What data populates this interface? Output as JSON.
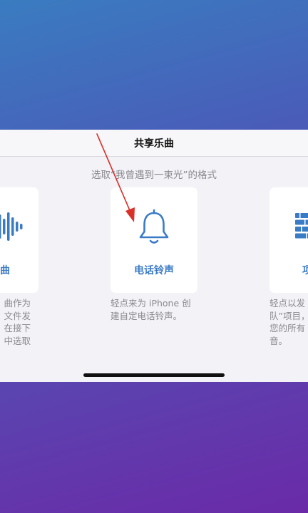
{
  "sheet": {
    "title": "共享乐曲",
    "subtitle": "选取“我曾遇到一束光”的格式"
  },
  "cards": {
    "left": {
      "label": "曲",
      "icon": "waveform-icon",
      "desc": [
        "曲作为",
        "文件发",
        "在接下",
        "中选取"
      ]
    },
    "center": {
      "label": "电话铃声",
      "icon": "bell-icon",
      "desc": [
        "轻点来为 iPhone 创",
        "建自定电话铃声。"
      ]
    },
    "right": {
      "label": "项",
      "icon": "tracks-icon",
      "desc": [
        "轻点以发",
        "队”项目，",
        "您的所有",
        "音。"
      ]
    }
  },
  "colors": {
    "accent": "#3a7bc6",
    "annotation_arrow": "#d9302a"
  }
}
